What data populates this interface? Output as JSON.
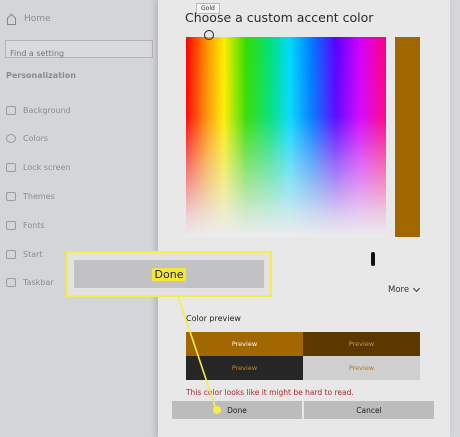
{
  "settings": {
    "home_label": "Home",
    "search_placeholder": "Find a setting",
    "section_label": "Personalization",
    "nav_items": [
      "Background",
      "Colors",
      "Lock screen",
      "Themes",
      "Fonts",
      "Start",
      "Taskbar"
    ]
  },
  "dialog": {
    "title": "Choose a custom accent color",
    "tooltip": "Gold",
    "more_label": "More",
    "preview_label": "Color preview",
    "preview_cells": [
      "Preview",
      "Preview",
      "Preview",
      "Preview"
    ],
    "warning": "This color looks like it might be hard to read.",
    "done_label": "Done",
    "cancel_label": "Cancel",
    "selected_color": "#a16700"
  },
  "callout": {
    "label": "Done"
  },
  "colors": {
    "accent": "#a16700",
    "highlight": "#f6ec4c",
    "warning": "#b3262d"
  }
}
